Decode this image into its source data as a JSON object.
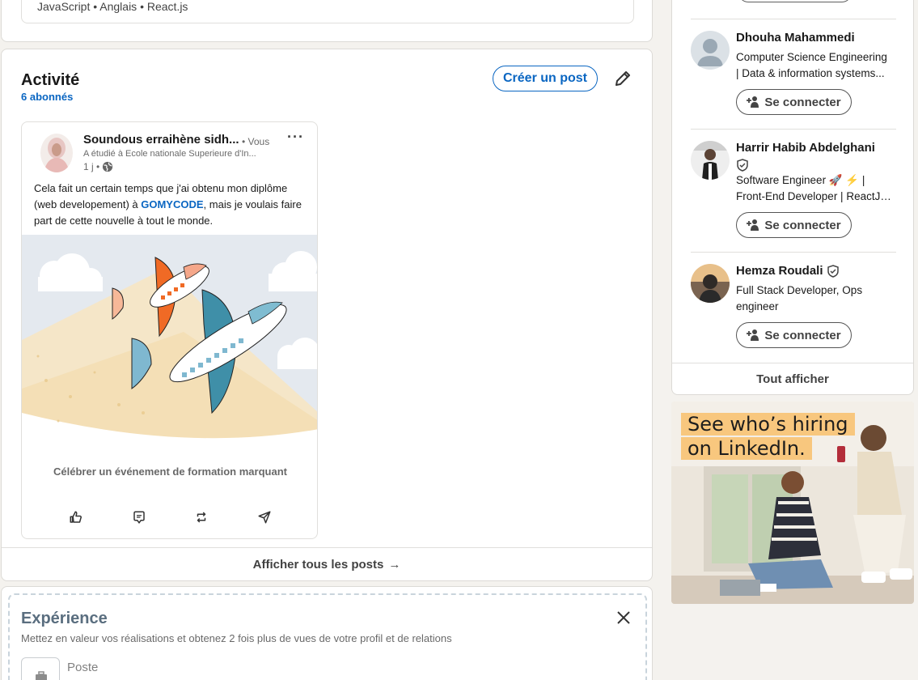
{
  "top_card": {
    "skills": "JavaScript • Anglais • React.js"
  },
  "activity": {
    "title": "Activité",
    "followers": "6 abonnés",
    "create_post_label": "Créer un post",
    "post": {
      "author": "Soundous erraihène sidh...",
      "you_badge": "• Vous",
      "subtitle": "A étudié à Ecole nationale Superieure d'In...",
      "time": "1 j •",
      "text_before": "Cela fait un certain temps que j'ai obtenu mon diplôme (web developement) à ",
      "text_link": "GOMYCODE",
      "text_after": ", mais je voulais faire part de cette nouvelle à tout le monde.",
      "caption": "Célébrer un événement de formation marquant",
      "more": "···"
    },
    "show_all": "Afficher tous les posts",
    "arrow": "→"
  },
  "experience": {
    "title": "Expérience",
    "description": "Mettez en valeur vos réalisations et obtenez 2 fois plus de vues de votre profil et de relations",
    "poste_placeholder": "Poste"
  },
  "sidebar": {
    "people": [
      {
        "name": "Dhouha Mahammedi",
        "desc_l1": "Computer Science Engineering",
        "desc_l2": "| Data & information systems...",
        "connect": "Se connecter"
      },
      {
        "name": "Harrir Habib Abdelghani",
        "desc_l1": "Software Engineer 🚀 ⚡ |",
        "desc_l2": "Front-End Developer | ReactJs...",
        "connect": "Se connecter"
      },
      {
        "name": "Hemza Roudali",
        "desc_l1": "Full Stack Developer, Ops",
        "desc_l2": "engineer",
        "connect": "Se connecter"
      }
    ],
    "show_all": "Tout afficher"
  },
  "ad": {
    "line1": "See who’s hiring",
    "line2": "on LinkedIn."
  },
  "colors": {
    "accent": "#0a66c2",
    "ad_highlight": "#f8c77e",
    "background": "#f4f2ee"
  }
}
